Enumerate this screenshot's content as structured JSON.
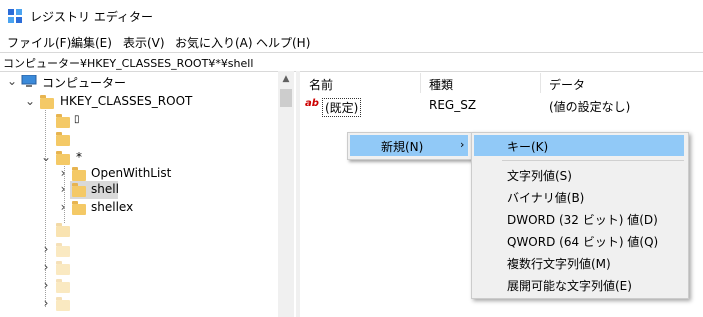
{
  "window": {
    "title": "レジストリ エディター"
  },
  "menu": [
    "ファイル(F)",
    "編集(E)",
    "表示(V)",
    "お気に入り(A)",
    "ヘルプ(H)"
  ],
  "address": "コンピューター¥HKEY_CLASSES_ROOT¥*¥shell",
  "tree": {
    "computer": "コンピューター",
    "root": "HKEY_CLASSES_ROOT",
    "star": "*",
    "openwithlist": "OpenWithList",
    "shell": "shell",
    "shellex": "shellex"
  },
  "columns": {
    "name": "名前",
    "type": "種類",
    "data": "データ"
  },
  "rows": [
    {
      "name": "(既定)",
      "type": "REG_SZ",
      "data": "(値の設定なし)"
    }
  ],
  "context_menu": {
    "new_label": "新規(N)",
    "submenu": {
      "key": "キー(K)",
      "string": "文字列値(S)",
      "binary": "バイナリ値(B)",
      "dword": "DWORD (32 ビット) 値(D)",
      "qword": "QWORD (64 ビット) 値(Q)",
      "multi": "複数行文字列値(M)",
      "expand": "展開可能な文字列値(E)"
    }
  }
}
